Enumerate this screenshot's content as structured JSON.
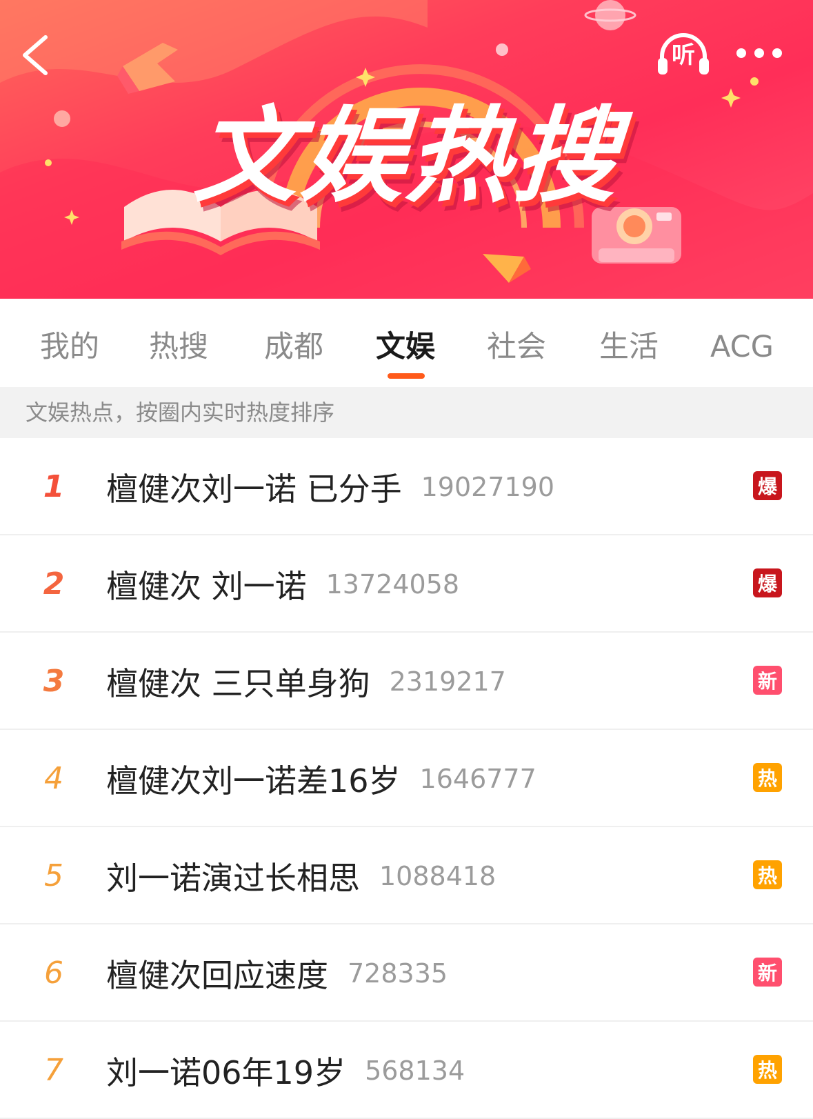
{
  "banner": {
    "title": "文娱热搜",
    "listen_label": "听"
  },
  "tabs": [
    {
      "label": "我的",
      "active": false
    },
    {
      "label": "热搜",
      "active": false
    },
    {
      "label": "成都",
      "active": false
    },
    {
      "label": "文娱",
      "active": true
    },
    {
      "label": "社会",
      "active": false
    },
    {
      "label": "生活",
      "active": false
    },
    {
      "label": "ACG",
      "active": false
    }
  ],
  "subtitle": "文娱热点，按圈内实时热度排序",
  "items": [
    {
      "rank": "1",
      "title": "檀健次刘一诺 已分手",
      "count": "19027190",
      "badge": "爆",
      "badge_color": "#c8161d"
    },
    {
      "rank": "2",
      "title": "檀健次 刘一诺",
      "count": "13724058",
      "badge": "爆",
      "badge_color": "#c8161d"
    },
    {
      "rank": "3",
      "title": "檀健次 三只单身狗",
      "count": "2319217",
      "badge": "新",
      "badge_color": "#ff4f6e"
    },
    {
      "rank": "4",
      "title": "檀健次刘一诺差16岁",
      "count": "1646777",
      "badge": "热",
      "badge_color": "#ffa200"
    },
    {
      "rank": "5",
      "title": "刘一诺演过长相思",
      "count": "1088418",
      "badge": "热",
      "badge_color": "#ffa200"
    },
    {
      "rank": "6",
      "title": "檀健次回应速度",
      "count": "728335",
      "badge": "新",
      "badge_color": "#ff4f6e"
    },
    {
      "rank": "7",
      "title": "刘一诺06年19岁",
      "count": "568134",
      "badge": "热",
      "badge_color": "#ffa200"
    }
  ]
}
